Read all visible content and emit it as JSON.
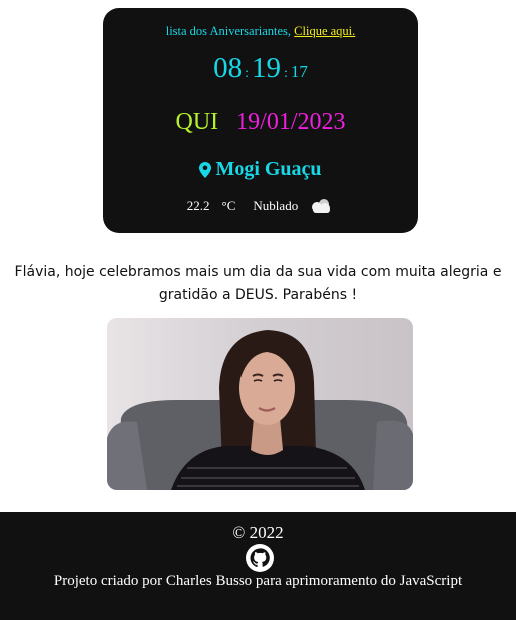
{
  "birthday": {
    "prefix": "lista dos Aniversariantes, ",
    "link_label": "Clique aqui."
  },
  "clock": {
    "hours": "08",
    "separator": ":",
    "minutes": "19",
    "seconds": "17"
  },
  "date": {
    "weekday": "QUI",
    "date": "19/01/2023"
  },
  "location": {
    "icon": "map-pin-icon",
    "city": "Mogi Guaçu"
  },
  "weather": {
    "temperature": "22.2",
    "unit": "°C",
    "condition": "Nublado",
    "icon": "cloud-icon"
  },
  "message": {
    "text": "Flávia, hoje celebramos mais um dia da sua vida com muita alegria e gratidão a DEUS. Parabéns !"
  },
  "colors": {
    "card_bg": "#111111",
    "cyan": "#18d7e6",
    "lime": "#b6f12d",
    "magenta": "#f01fe0",
    "link_yellow": "#f3f01e"
  },
  "footer": {
    "copyright": "© 2022",
    "github_icon": "github-icon",
    "credits": "Projeto criado por Charles Busso para aprimoramento do JavaScript"
  }
}
